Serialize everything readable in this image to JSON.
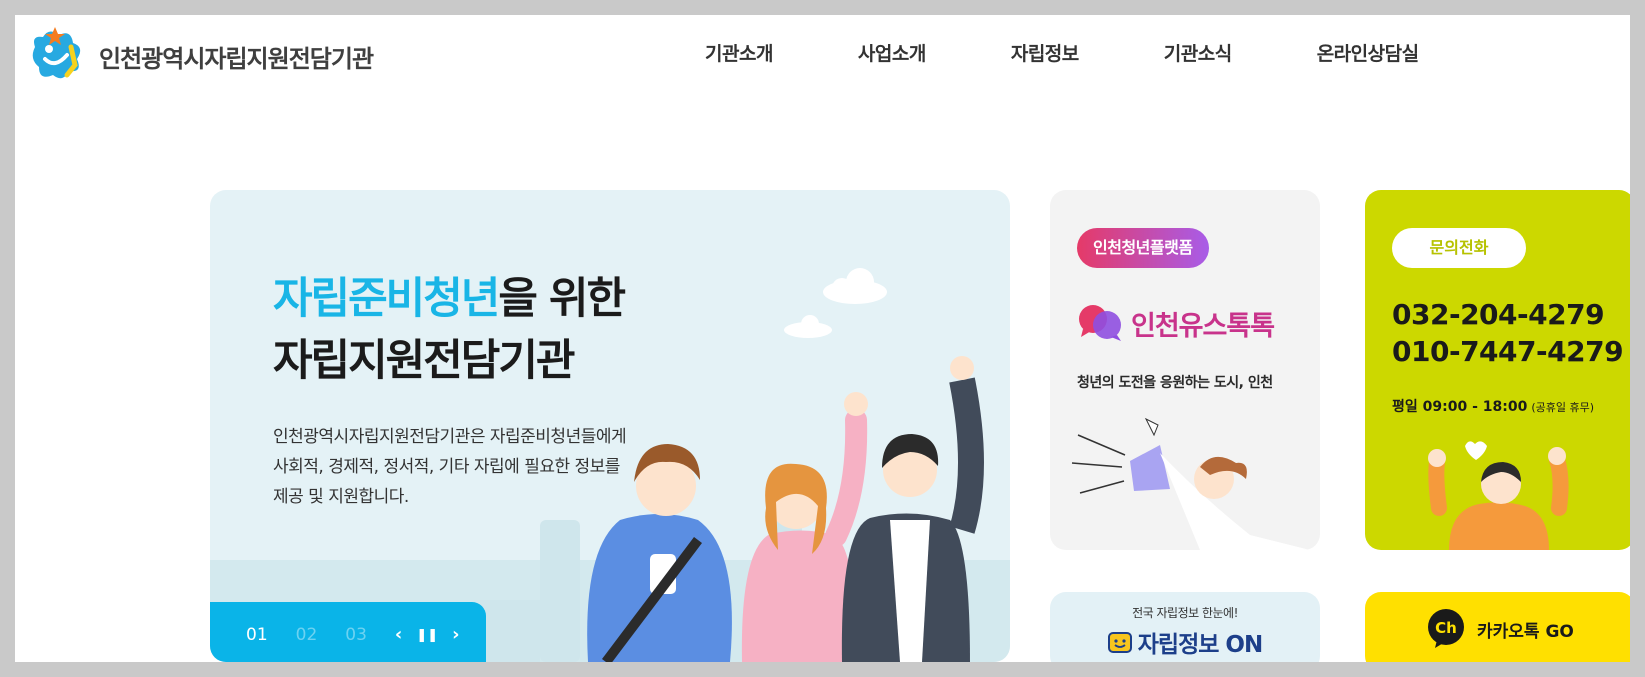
{
  "header": {
    "logo_text": "인천광역시자립지원전담기관",
    "nav": [
      "기관소개",
      "사업소개",
      "자립정보",
      "기관소식",
      "온라인상담실"
    ]
  },
  "hero": {
    "title_highlight": "자립준비청년",
    "title_rest": "을 위한",
    "title_line2": "자립지원전담기관",
    "desc_lines": [
      "인천광역시자립지원전담기관은 자립준비청년들에게",
      "사회적, 경제적, 정서적, 기타 자립에 필요한 정보를",
      "제공 및 지원합니다."
    ],
    "slides": [
      "01",
      "02",
      "03"
    ],
    "prev_icon": "chevron-left-icon",
    "pause_icon": "pause-icon",
    "next_icon": "chevron-right-icon"
  },
  "platform_card": {
    "pill": "인천청년플랫폼",
    "brand": "인천유스톡톡",
    "desc": "청년의 도전을 응원하는 도시, 인천"
  },
  "phone_card": {
    "pill": "문의전화",
    "numbers": [
      "032-204-4279",
      "010-7447-4279"
    ],
    "hours": "평일  09:00 - 18:00",
    "hours_note": "(공휴일 휴무)"
  },
  "on_card": {
    "small": "전국 자립정보 한눈에!",
    "brand": "자립정보 ON"
  },
  "kakao_card": {
    "label": "카카오톡 GO",
    "icon_text": "Ch"
  },
  "colors": {
    "accent": "#19b5e6",
    "slider": "#0ab4e8",
    "phone_bg": "#ccd800",
    "kakao_bg": "#ffe000",
    "brand_pink": "#c8338b"
  }
}
